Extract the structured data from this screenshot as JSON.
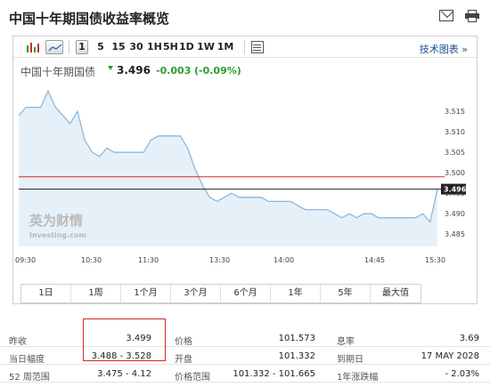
{
  "header": {
    "title": "中国十年期国债收益率概览"
  },
  "toolbar": {
    "intervals": [
      "1",
      "5",
      "15",
      "30",
      "1H",
      "5H",
      "1D",
      "1W",
      "1M"
    ],
    "active_interval": "1",
    "tech_chart_link": "技术图表 »"
  },
  "quote": {
    "name": "中国十年期国债",
    "price": "3.496",
    "change": "-0.003",
    "change_pct": "(-0.09%)",
    "direction": "down",
    "color_change": "#2a9d2a"
  },
  "chart_data": {
    "type": "area",
    "title": "",
    "xlabel": "",
    "ylabel": "",
    "x_tick_labels": [
      "09:30",
      "10:30",
      "11:30",
      "13:30",
      "14:00",
      "14:45",
      "15:30"
    ],
    "y_tick_labels": [
      "3.515",
      "3.510",
      "3.505",
      "3.500",
      "3.495",
      "3.490",
      "3.485"
    ],
    "ylim": [
      3.482,
      3.522
    ],
    "previous_close": 3.499,
    "last_price_label": "3.496",
    "series": [
      {
        "values": [
          3.514,
          3.516,
          3.516,
          3.516,
          3.52,
          3.516,
          3.514,
          3.512,
          3.515,
          3.508,
          3.505,
          3.504,
          3.506,
          3.505,
          3.505,
          3.505,
          3.505,
          3.505,
          3.508,
          3.509,
          3.509,
          3.509,
          3.509,
          3.506,
          3.501,
          3.497,
          3.494,
          3.493,
          3.494,
          3.495,
          3.494,
          3.494,
          3.494,
          3.494,
          3.493,
          3.493,
          3.493,
          3.493,
          3.492,
          3.491,
          3.491,
          3.491,
          3.491,
          3.49,
          3.489,
          3.49,
          3.489,
          3.49,
          3.49,
          3.489,
          3.489,
          3.489,
          3.489,
          3.489,
          3.489,
          3.49,
          3.488,
          3.496
        ]
      }
    ],
    "watermark": "英为财情 Investing.com",
    "colors": {
      "line": "#8cb8dd",
      "fill": "#e6f0f8",
      "prev_close_line": "#d9262a",
      "last_line": "#222222"
    }
  },
  "ranges": [
    "1日",
    "1周",
    "1个月",
    "3个月",
    "6个月",
    "1年",
    "5年",
    "最大值"
  ],
  "stats": {
    "rows": [
      [
        {
          "label": "昨收",
          "value": "3.499"
        },
        {
          "label": "价格",
          "value": "101.573"
        },
        {
          "label": "息率",
          "value": "3.69"
        }
      ],
      [
        {
          "label": "当日幅度",
          "value": "3.488 - 3.528"
        },
        {
          "label": "开盘",
          "value": "101.332"
        },
        {
          "label": "到期日",
          "value": "17 MAY 2028"
        }
      ],
      [
        {
          "label": "52 周范围",
          "value": "3.475 - 4.12"
        },
        {
          "label": "价格范围",
          "value": "101.332 - 101.665"
        },
        {
          "label": "1年涨跌幅",
          "value": "- 2.03%"
        }
      ]
    ]
  }
}
